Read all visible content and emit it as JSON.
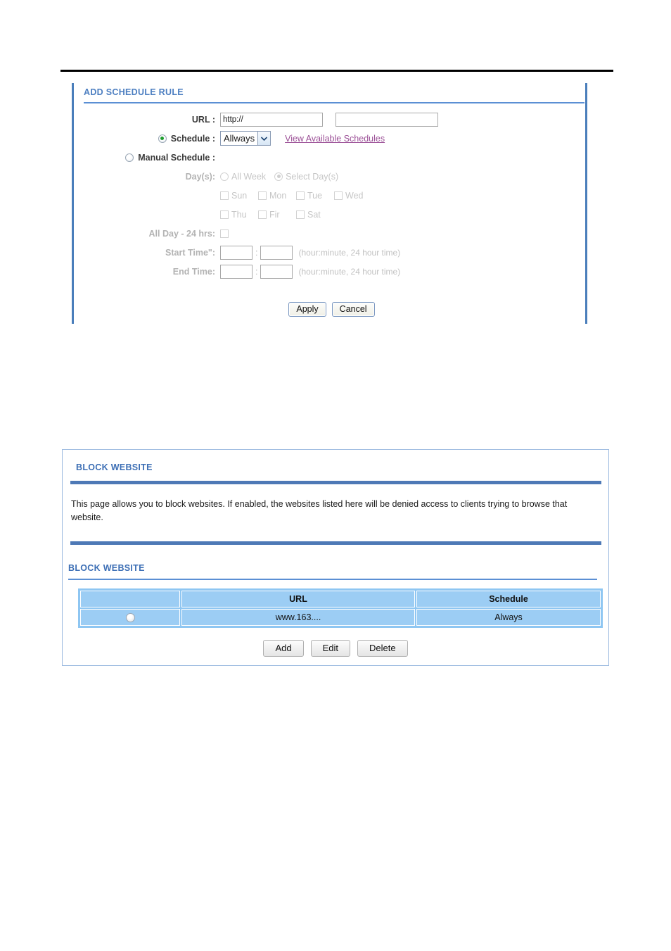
{
  "schedule_panel": {
    "title": "ADD SCHEDULE RULE",
    "url_label": "URL :",
    "url_value": "http://",
    "url_value2": "",
    "schedule_label": "Schedule :",
    "schedule_selected": "Allways",
    "schedule_options": [
      "Allways"
    ],
    "view_schedules_link": "View Available Schedules",
    "manual_schedule_label": "Manual Schedule :",
    "days_label": "Day(s):",
    "all_week_label": "All Week",
    "select_days_label": "Select Day(s)",
    "days_row1": [
      "Sun",
      "Mon",
      "Tue",
      "Wed"
    ],
    "days_row2": [
      "Thu",
      "Fir",
      "Sat"
    ],
    "all_day_label": "All Day - 24 hrs:",
    "start_time_label": "Start Time\":",
    "end_time_label": "End Time:",
    "start_hour": "",
    "start_minute": "",
    "end_hour": "",
    "end_minute": "",
    "time_colon": ":",
    "time_hint": "(hour:minute, 24 hour time)",
    "apply_label": "Apply",
    "cancel_label": "Cancel"
  },
  "block_panel": {
    "title": "BLOCK WEBSITE",
    "description": "This page allows you to block websites. If enabled, the websites listed here will be denied access to clients trying to browse that website.",
    "section_title": "BLOCK WEBSITE",
    "columns": [
      "",
      "URL",
      "Schedule"
    ],
    "rows": [
      {
        "selected": "",
        "url": "www.163....",
        "schedule": "Always"
      }
    ],
    "add_label": "Add",
    "edit_label": "Edit",
    "delete_label": "Delete"
  },
  "colors": {
    "heading_blue": "#4d7fc1",
    "rule_blue": "#5b8fd4",
    "bar_blue": "#4e79b6",
    "table_blue": "#9ccdf4",
    "link_purple": "#9b4f96",
    "radio_green": "#1e9c2e"
  }
}
